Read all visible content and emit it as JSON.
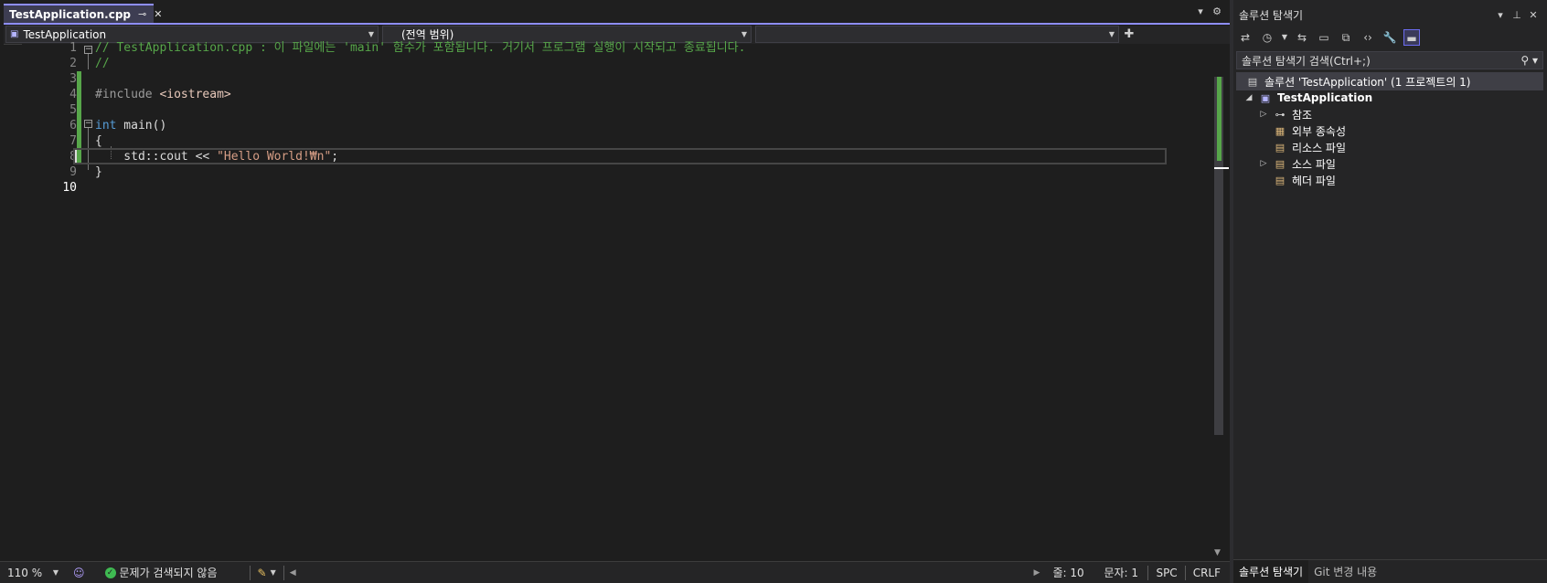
{
  "editor_tab": {
    "filename": "TestApplication.cpp",
    "pin_icon": "pin-icon",
    "close_icon": "close-icon"
  },
  "navbar": {
    "project": "TestApplication",
    "scope": "(전역 범위)",
    "member": ""
  },
  "code": {
    "line_numbers": [
      "1",
      "2",
      "3",
      "4",
      "5",
      "6",
      "7",
      "8",
      "9",
      "10"
    ],
    "line1_comment": "// TestApplication.cpp : 이 파일에는 'main' 함수가 포함됩니다. 거기서 프로그램 실행이 시작되고 종료됩니다.",
    "line2_comment": "//",
    "line4_directive": "#include ",
    "line4_header": "<iostream>",
    "line6_keyword": "int",
    "line6_rest": " main()",
    "line7": "{",
    "line8_code": "    std::cout << ",
    "line8_string": "\"Hello World!₩n\"",
    "line8_end": ";",
    "line9": "}"
  },
  "status": {
    "zoom": "110 %",
    "issues": "문제가 검색되지 않음",
    "line": "줄: 10",
    "column": "문자: 1",
    "whitespace": "SPC",
    "line_ending": "CRLF"
  },
  "solution_explorer": {
    "title": "솔루션 탐색기",
    "search_placeholder": "솔루션 탐색기 검색(Ctrl+;)",
    "solution_label": "솔루션 'TestApplication' (1 프로젝트의 1)",
    "project": "TestApplication",
    "items": [
      "참조",
      "외부 종속성",
      "리소스 파일",
      "소스 파일",
      "헤더 파일"
    ],
    "tabs": [
      "솔루션 탐색기",
      "Git 변경 내용"
    ]
  },
  "colors": {
    "accent": "#8e8eff",
    "change_bar": "#57a64a",
    "comment": "#57a64a",
    "keyword": "#569cd6",
    "string": "#d69d85"
  }
}
